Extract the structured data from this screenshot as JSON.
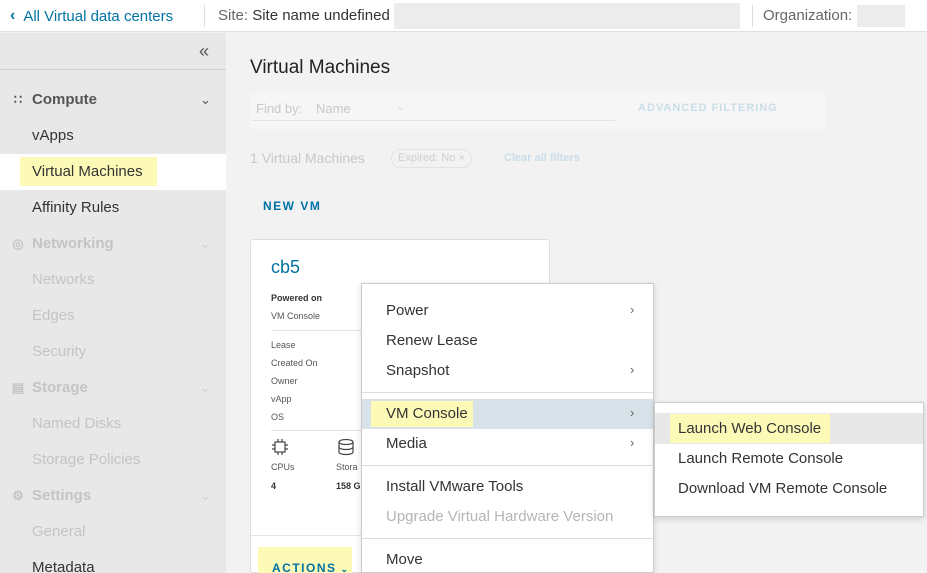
{
  "topbar": {
    "back_label": "All Virtual data centers",
    "site_label": "Site:",
    "site_value": "Site name undefined",
    "org_label": "Organization:"
  },
  "sidebar": {
    "collapse_icon": "double-chevron-left-icon",
    "sections": [
      {
        "label": "Compute",
        "icon": "grid-icon",
        "items": [
          "vApps",
          "Virtual Machines",
          "Affinity Rules"
        ]
      },
      {
        "label": "Networking",
        "icon": "network-icon",
        "items": [
          "Networks",
          "Edges",
          "Security"
        ]
      },
      {
        "label": "Storage",
        "icon": "storage-icon",
        "items": [
          "Named Disks",
          "Storage Policies"
        ]
      },
      {
        "label": "Settings",
        "icon": "gear-icon",
        "items": [
          "General",
          "Metadata"
        ]
      }
    ],
    "active_item": "Virtual Machines"
  },
  "main": {
    "title": "Virtual Machines",
    "find_by_label": "Find by:",
    "find_by_value": "Name",
    "advanced_filtering": "ADVANCED FILTERING",
    "vm_count": "1",
    "vm_count_label": "Virtual Machines",
    "chip_label": "Expired: No",
    "chip_close": "×",
    "clear_all": "Clear all filters",
    "new_vm": "NEW VM"
  },
  "card": {
    "name": "cb5",
    "status_title": "Powered on",
    "status_sub": "VM Console",
    "fields": [
      "Lease",
      "Created On",
      "Owner",
      "vApp",
      "OS"
    ],
    "cpus_label": "CPUs",
    "cpus_value": "4",
    "storage_label": "Stora",
    "storage_value": "158 G",
    "actions": "ACTIONS"
  },
  "context_menu": {
    "items": [
      {
        "label": "Power",
        "submenu": true
      },
      {
        "label": "Renew Lease",
        "submenu": false
      },
      {
        "label": "Snapshot",
        "submenu": true
      },
      {
        "label": "VM Console",
        "submenu": true,
        "active": true
      },
      {
        "label": "Media",
        "submenu": true
      },
      {
        "label": "Install VMware Tools",
        "submenu": false
      },
      {
        "label": "Upgrade Virtual Hardware Version",
        "submenu": false,
        "disabled": true
      },
      {
        "label": "Move",
        "submenu": false
      }
    ]
  },
  "submenu": {
    "items": [
      "Launch Web Console",
      "Launch Remote Console",
      "Download VM Remote Console"
    ],
    "hovered": "Launch Web Console"
  },
  "colors": {
    "link": "#0072a3",
    "highlight": "#fdfab8",
    "menu_active": "#d8e3e9"
  }
}
